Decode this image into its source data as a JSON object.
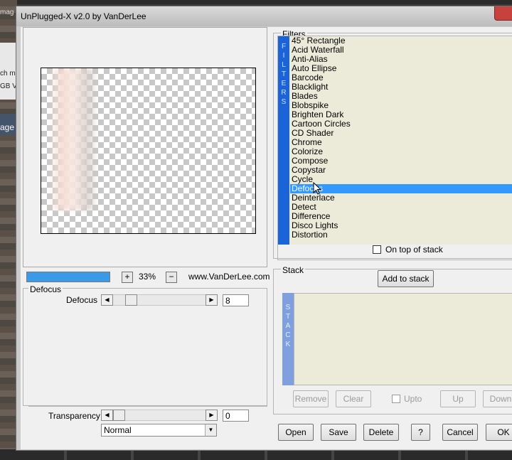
{
  "background": {
    "frag_1": "mag",
    "frag_2": "ch m",
    "frag_3": "GB V",
    "frag_4": "age"
  },
  "window": {
    "title": "UnPlugged-X v2.0 by VanDerLee"
  },
  "preview": {
    "zoom_in_label": "+",
    "zoom_value": "33%",
    "zoom_out_label": "−",
    "website": "www.VanDerLee.com",
    "progress_fraction": 1.0
  },
  "defocus_group": {
    "title": "Defocus",
    "param_label": "Defocus",
    "param_value": "8"
  },
  "transparency": {
    "label": "Transparency",
    "value": "0",
    "blend_mode": "Normal"
  },
  "filters": {
    "title": "Filters",
    "tab_letters": [
      "F",
      "I",
      "L",
      "T",
      "E",
      "R",
      "S"
    ],
    "items": [
      "45° Rectangle",
      "Acid Waterfall",
      "Anti-Alias",
      "Auto Ellipse",
      "Barcode",
      "Blacklight",
      "Blades",
      "Blobspike",
      "Brighten Dark",
      "Cartoon Circles",
      "CD Shader",
      "Chrome",
      "Colorize",
      "Compose",
      "Copystar",
      "Cycle",
      "Defocus",
      "Deinterlace",
      "Detect",
      "Difference",
      "Disco Lights",
      "Distortion"
    ],
    "selected": "Defocus",
    "on_top_label": "On top of stack",
    "selection_color": "#3399ff",
    "tab_color": "#1a64d8"
  },
  "stack": {
    "title": "Stack",
    "add_button": "Add to stack",
    "tab_letters": [
      "S",
      "T",
      "A",
      "C",
      "K"
    ],
    "remove": "Remove",
    "clear": "Clear",
    "upto": "Upto",
    "up": "Up",
    "down": "Down"
  },
  "bottom_buttons": {
    "open": "Open",
    "save": "Save",
    "delete": "Delete",
    "help": "?",
    "cancel": "Cancel",
    "ok": "OK"
  }
}
